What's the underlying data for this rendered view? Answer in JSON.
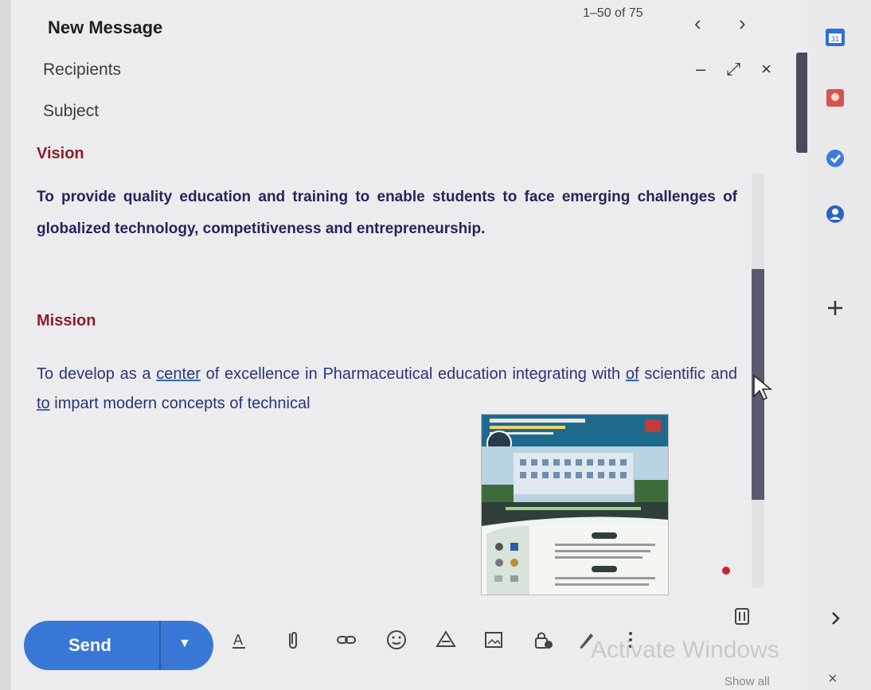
{
  "compose": {
    "title": "New Message",
    "pagination": "1–50 of 75",
    "recipients_placeholder": "Recipients",
    "subject_placeholder": "Subject",
    "window_controls": {
      "minimize": "–",
      "expand": "⤢",
      "close": "×"
    }
  },
  "body": {
    "vision_heading": "Vision",
    "vision_text": "To provide quality education and training to enable students to face emerging challenges of globalized technology, competitiveness and entrepreneurship.",
    "mission_heading": "Mission",
    "mission_text": {
      "p1": "To develop as a ",
      "w1": "center",
      "p2": " of excellence in Pharmaceutical education integrating with ",
      "w2": "of",
      "p3": " scientific and ",
      "w3": "to",
      "p4": " impart modern concepts of technical"
    },
    "attachment": "college flyer image"
  },
  "toolbar": {
    "send_label": "Send",
    "icons": [
      "format-text-icon",
      "attach-icon",
      "link-icon",
      "emoji-icon",
      "drive-icon",
      "photo-icon",
      "confidential-lock-icon",
      "signature-pen-icon",
      "more-options-icon",
      "trash-icon"
    ]
  },
  "rail": {
    "icons": [
      "calendar-icon",
      "keep-icon",
      "tasks-icon",
      "contacts-icon",
      "add-icon",
      "expand-panel-icon"
    ]
  },
  "footer": {
    "show_all": "Show all",
    "close": "×",
    "watermark": "Activate Windows"
  },
  "colors": {
    "heading": "#8b1e2b",
    "body_text": "#23265a",
    "send_button": "#3977d6",
    "calendar": "#2f6fd6",
    "keep": "#d9534f",
    "tasks": "#3b7be0",
    "contacts": "#2a62c9"
  }
}
